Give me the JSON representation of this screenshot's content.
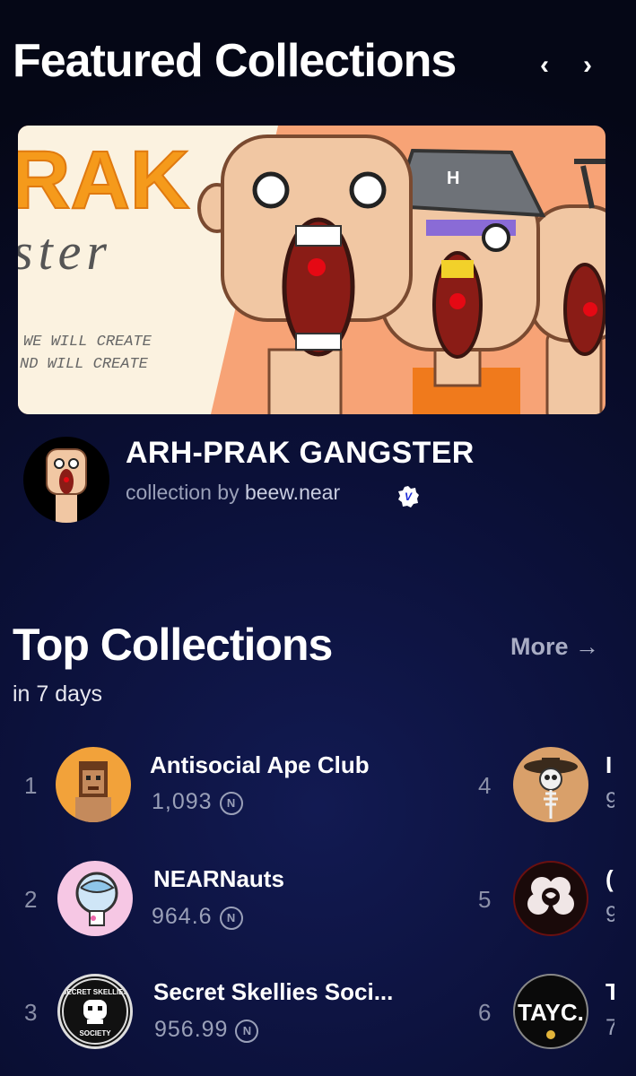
{
  "featured": {
    "title": "Featured Collections",
    "prev_label": "‹",
    "next_label": "›",
    "banner": {
      "title_top": "RAK",
      "title_bottom": "ster",
      "line1": "WE WILL CREATE",
      "line2": "ND WILL CREATE",
      "hat_letter": "H"
    },
    "collection": {
      "name": "ARH-PRAK GANGSTER",
      "by_label": "collection by",
      "owner": "beew.near",
      "verified": true
    }
  },
  "top": {
    "title": "Top Collections",
    "subtitle": "in 7 days",
    "more_label": "More →",
    "currency_symbol": "N",
    "items": [
      {
        "rank": "1",
        "name": "Antisocial Ape Club",
        "volume": "1,093"
      },
      {
        "rank": "2",
        "name": "NEARNauts",
        "volume": "964.6"
      },
      {
        "rank": "3",
        "name": "Secret Skellies Soci...",
        "volume": "956.99"
      },
      {
        "rank": "4",
        "name": "I",
        "volume": "9"
      },
      {
        "rank": "5",
        "name": "(",
        "volume": "9"
      },
      {
        "rank": "6",
        "name": "T",
        "volume": "7"
      }
    ],
    "avatar_text": {
      "skellies_top": "SECRET SKELLIES",
      "skellies_bottom": "SOCIETY",
      "tayc": "TAYC."
    }
  },
  "colors": {
    "background": "#0b1038",
    "muted_text": "#9aa0b8",
    "banner_orange": "#f7a376",
    "near_blue": "#1c2bd8"
  }
}
